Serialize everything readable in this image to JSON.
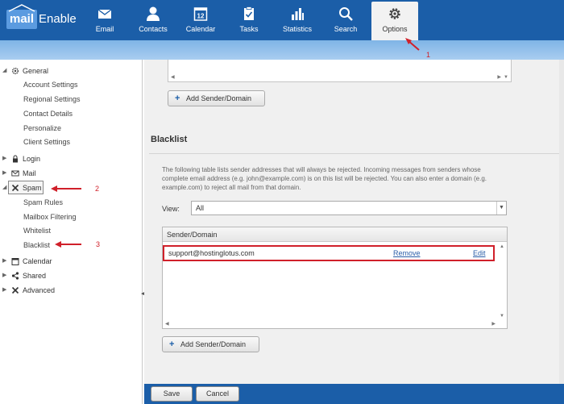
{
  "app": {
    "logo_left": "mail",
    "logo_right": "Enable"
  },
  "nav": [
    {
      "label": "Email",
      "icon": "envelope-icon"
    },
    {
      "label": "Contacts",
      "icon": "person-icon"
    },
    {
      "label": "Calendar",
      "icon": "calendar-icon",
      "icon_text": "12"
    },
    {
      "label": "Tasks",
      "icon": "clipboard-icon"
    },
    {
      "label": "Statistics",
      "icon": "bar-chart-icon"
    },
    {
      "label": "Search",
      "icon": "search-icon"
    },
    {
      "label": "Options",
      "icon": "gear-icon",
      "active": true
    }
  ],
  "sidebar": {
    "general": "General",
    "general_items": [
      "Account Settings",
      "Regional Settings",
      "Contact Details",
      "Personalize",
      "Client Settings"
    ],
    "login": "Login",
    "mail": "Mail",
    "spam": "Spam",
    "spam_items": [
      "Spam Rules",
      "Mailbox Filtering",
      "Whitelist",
      "Blacklist"
    ],
    "calendar": "Calendar",
    "shared": "Shared",
    "advanced": "Advanced"
  },
  "main": {
    "add_sender_top": "Add Sender/Domain",
    "blacklist_title": "Blacklist",
    "description": "The following table lists sender addresses that will always be rejected. Incoming messages from senders whose complete email address (e.g. john@example.com) is on this list will be rejected. You can also enter a domain (e.g. example.com) to reject all mail from that domain.",
    "view_label": "View:",
    "view_value": "All",
    "grid_header": "Sender/Domain",
    "rows": [
      {
        "email": "support@hostinglotus.com",
        "remove": "Remove",
        "edit": "Edit"
      }
    ],
    "add_sender_bottom": "Add Sender/Domain"
  },
  "footer": {
    "save": "Save",
    "cancel": "Cancel"
  },
  "annotations": [
    "1",
    "2",
    "3"
  ],
  "colors": {
    "nav_bg": "#1b5ea8",
    "annotation": "#d0202a"
  }
}
